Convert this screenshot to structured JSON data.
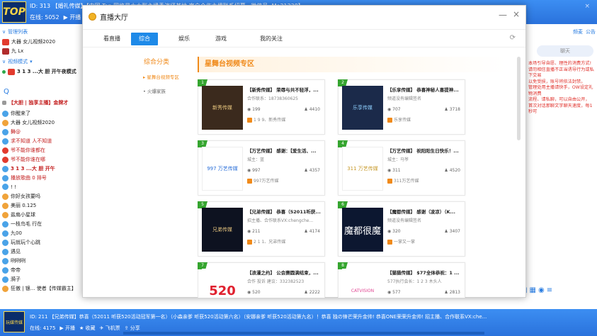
{
  "bg_top": {
    "logo": "TOP",
    "line1": "ID: 313 【婚礼传媒】【中国 Top 网络最大大型主播秀演绎基地 客户合作主播联系招募...微信号: Mo31338】",
    "online_label": "在线: 5052",
    "open_label": "开播",
    "close_glyph": "×"
  },
  "left_list": {
    "group_header": "管理列表",
    "user1": "大器 女儿视频2020",
    "user2": "九 Lx",
    "mode_header": "视频模式",
    "mic_user": "3 1 3 ...大 胆 开午夜模式",
    "search_icon": "Q",
    "room_title": "【大胆 | 独享主播】金牌才",
    "members": [
      "你醒来了",
      "大器 女儿视频2020",
      "舞@",
      "求不知道 人不知道",
      "爷不能你谁都在",
      "爷不能你谁在哪",
      "3 1 3 ...大 胆 开午",
      "播放歌曲 0 排号",
      "! !",
      "你好女孩要吗",
      "美丽 0.125",
      "盐扇小星球",
      "一枝鸟毛 行在",
      "九00",
      "玩就玩个心跳",
      "遇见",
      "咧咧咧",
      "帝帝",
      "漪子",
      "狂傲 | 银... 使者【传媒霸主】"
    ]
  },
  "right_panel": {
    "tab1": "频麦",
    "tab2": "公告",
    "chat_btn": "聊天",
    "notice": "本场引导自愿、理性的消费方式!\n请勿相信直播不正当诱导行为或私下交易\n以免受损，账号将依法封禁。\n管理处用主播请快手，OW设定礼物消费\n流程、请私聊，可以自由公开，\n首次对话那聊文字聊天速度，每1秒可"
  },
  "bg_bottom": {
    "logo_text": "玩媒传媒",
    "line1": "ID: 211 【兄弟传媒】恭喜（52011 听获520活动冠军第一名）（小森亲爹 听获520活动第六名）（安娜亲爹 听获520活动第九名）！恭喜 独の锋芒荣升金帅! 恭喜ONE荣荣升金帅! 招主播、合作联系VX:che...",
    "online_label": "在线: 4175",
    "open_label": "开播",
    "collect_label": "收藏",
    "fly_label": "飞机票",
    "share_label": "分享"
  },
  "dialog": {
    "title": "直播大厅",
    "min_glyph": "—",
    "close_glyph": "×",
    "refresh_glyph": "⟳",
    "nav": [
      "看直播",
      "综合",
      "娱乐",
      "游戏",
      "我的关注"
    ],
    "active_nav": "综合",
    "side_title": "综合分类",
    "side_items": [
      "▸ 星舞台视频专区",
      "• 火爆家族"
    ],
    "section_title": "星舞台视频专区",
    "cards": [
      {
        "num": "1",
        "name": "【新秀传媒】 荣辱与共不轻浮，...",
        "sub": "合作联系：18738360625",
        "viewers": "199",
        "fans": "4410",
        "host": "1 9 9、新秀传媒",
        "thumb": "新秀传媒"
      },
      {
        "num": "2",
        "name": "【乐享传媒】 恭喜神秘人喜提神...",
        "sub": "频道没有编辑签名",
        "viewers": "707",
        "fans": "3718",
        "host": "乐享传媒",
        "thumb": "乐享传媒"
      },
      {
        "num": "3",
        "name": "【万艺传媒】 感谢：【爱生活、...",
        "sub": "城主：蓝",
        "viewers": "997",
        "fans": "4357",
        "host": "997万艺传媒",
        "thumb": "997 万艺传媒"
      },
      {
        "num": "4",
        "name": "【万艺传媒】 祝阳阳生日快乐！...",
        "sub": "城主：马爷",
        "viewers": "311",
        "fans": "4520",
        "host": "311万艺传媒",
        "thumb": "311 万艺传媒"
      },
      {
        "num": "5",
        "name": "【兄弟传媒】 恭喜（52011听获...",
        "sub": "招主播、合作联系VX:chengche...",
        "viewers": "211",
        "fans": "4174",
        "host": "2 1 1、兄弟传媒",
        "thumb": "兄弟传媒"
      },
      {
        "num": "6",
        "name": "【魔都传媒】 感谢（凌凉）（K...",
        "sub": "频道没有编辑签名",
        "viewers": "320",
        "fans": "3407",
        "host": "一掌又一掌",
        "thumb": "魔都很魔"
      },
      {
        "num": "7",
        "name": "【浪漫之约】 公会赛圆满结束，...",
        "sub": "合作 投诉 建议：332382523",
        "viewers": "520",
        "fans": "2222",
        "host": "",
        "thumb": "520"
      },
      {
        "num": "8",
        "name": "【猫猫传媒】 $77全体恭祝：1 ...",
        "sub": "577执行会长：1 2 3 木头人",
        "viewers": "577",
        "fans": "2813",
        "host": "",
        "thumb": "CATVISION"
      }
    ]
  },
  "colors": {
    "accent_blue": "#1e8ae8",
    "accent_orange": "#f08a1a",
    "title_bar": "#2f7ee6",
    "badge_green": "#35a52f"
  }
}
